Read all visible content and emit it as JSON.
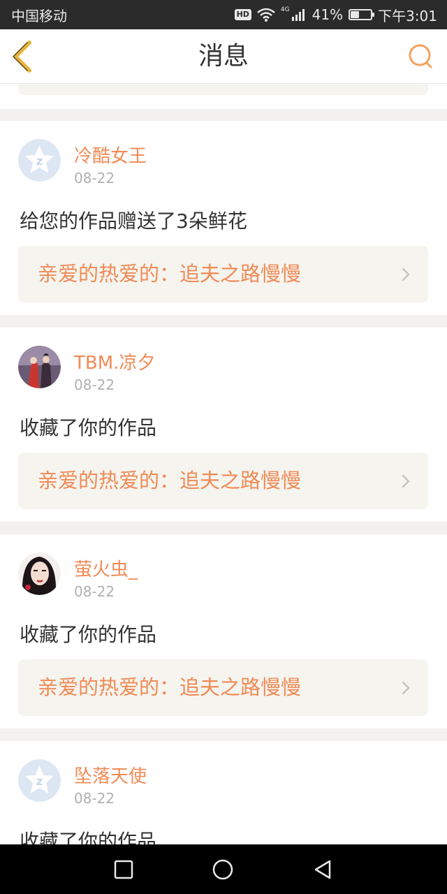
{
  "status_bar": {
    "carrier": "中国移动",
    "hd": "HD",
    "network": "4G",
    "battery": "41%",
    "battery_level": 0.41,
    "time": "下午3:01"
  },
  "nav": {
    "title": "消息"
  },
  "messages": [
    {
      "username": "冷酷女王",
      "date": "08-22",
      "text": "给您的作品赠送了3朵鲜花",
      "link": "亲爱的热爱的：追夫之路慢慢",
      "avatar": "default-avatar"
    },
    {
      "username": "TBM.凉夕",
      "date": "08-22",
      "text": "收藏了你的作品",
      "link": "亲爱的热爱的：追夫之路慢慢",
      "avatar": "photo-avatar-couple"
    },
    {
      "username": "萤火虫_",
      "date": "08-22",
      "text": "收藏了你的作品",
      "link": "亲爱的热爱的：追夫之路慢慢",
      "avatar": "photo-avatar-girl"
    },
    {
      "username": "坠落天使",
      "date": "08-22",
      "text": "收藏了你的作品",
      "link": "",
      "avatar": "default-avatar"
    }
  ],
  "colors": {
    "accent": "#f08a55",
    "back_arrow": "#e7b53c",
    "card_bg": "#ffffff",
    "link_bg": "#f5f4ef"
  }
}
